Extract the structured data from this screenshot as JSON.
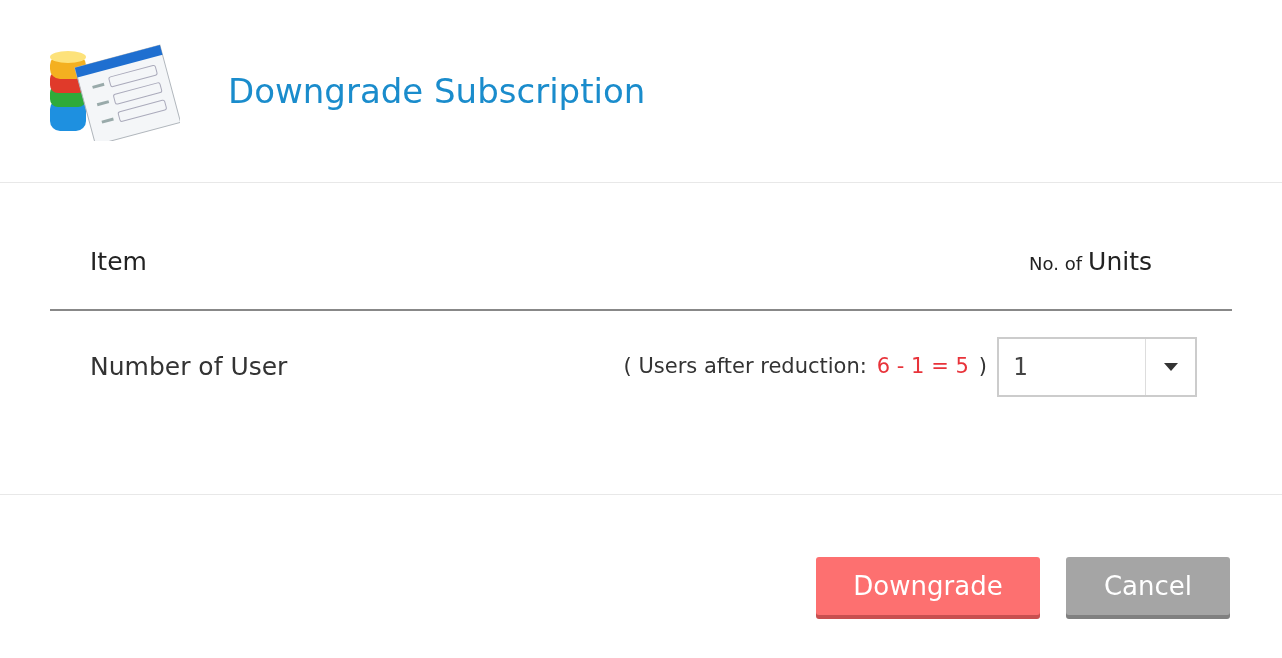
{
  "dialog": {
    "title": "Downgrade Subscription"
  },
  "table": {
    "columns": [
      {
        "label": "Item"
      },
      {
        "prefix": "No. of",
        "label": "Units"
      }
    ],
    "rows": [
      {
        "item": "Number of User",
        "note_before": "( Users after reduction:",
        "note_value": "6 - 1 = 5",
        "note_after": ")",
        "units": {
          "value": "1"
        }
      }
    ]
  },
  "buttons": [
    {
      "label": "Downgrade",
      "kind": "primary"
    },
    {
      "label": "Cancel",
      "kind": "secondary"
    }
  ]
}
